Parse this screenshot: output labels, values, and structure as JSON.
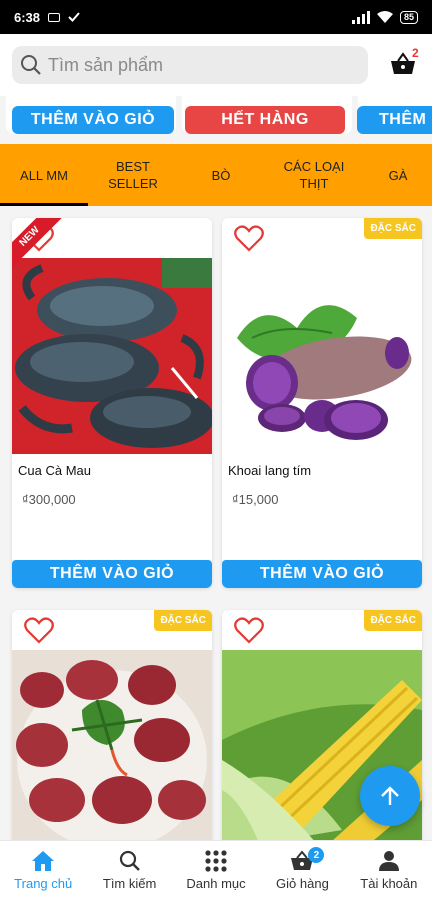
{
  "status_bar": {
    "time": "6:38",
    "battery": "85"
  },
  "header": {
    "search_placeholder": "Tìm sản phẩm",
    "cart_count": "2"
  },
  "strip": {
    "btn1": "THÊM VÀO GIỎ",
    "btn2": "HẾT HÀNG",
    "btn3": "THÊM"
  },
  "tabs": [
    {
      "label": "ALL MM"
    },
    {
      "label_line1": "BEST",
      "label_line2": "SELLER"
    },
    {
      "label": "BÒ"
    },
    {
      "label_line1": "CÁC LOẠI",
      "label_line2": "THỊT"
    },
    {
      "label": "GÀ"
    }
  ],
  "products": [
    {
      "name": "Cua Cà Mau",
      "price": "₫300,000",
      "ribbon": "NEW",
      "button": "THÊM VÀO GIỎ"
    },
    {
      "name": "Khoai lang tím",
      "price": "₫15,000",
      "tag": "ĐẶC SẮC",
      "button": "THÊM VÀO GIỎ"
    },
    {
      "tag": "ĐẶC SẮC"
    },
    {
      "tag": "ĐẶC SẮC"
    }
  ],
  "bottom_nav": [
    {
      "label": "Trang chủ",
      "icon": "home-icon"
    },
    {
      "label": "Tìm kiếm",
      "icon": "search-icon"
    },
    {
      "label": "Danh mục",
      "icon": "grid-icon"
    },
    {
      "label": "Giỏ hàng",
      "icon": "basket-icon",
      "badge": "2"
    },
    {
      "label": "Tài khoản",
      "icon": "user-icon"
    }
  ],
  "colors": {
    "accent": "#1e9bf0",
    "tab_bar": "#ffa000",
    "out_of_stock": "#e84545",
    "tag": "#f7c51f"
  }
}
